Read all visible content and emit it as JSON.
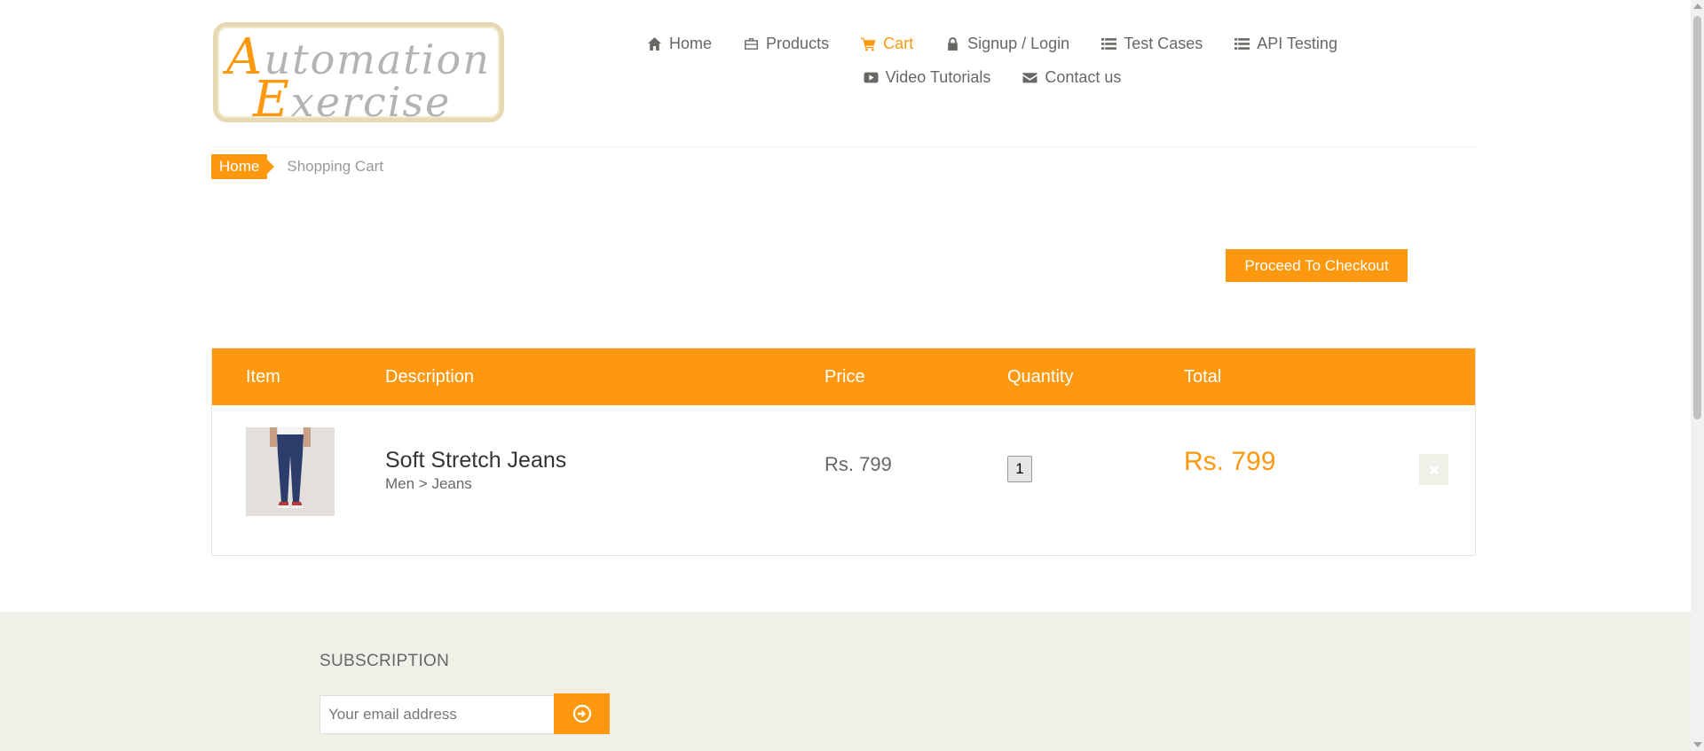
{
  "logo": {
    "line1_cap": "A",
    "line1_rest": "utomation",
    "line2_cap": "E",
    "line2_rest": "xercise"
  },
  "nav": {
    "items": [
      {
        "label": "Home",
        "icon": "home-icon"
      },
      {
        "label": "Products",
        "icon": "briefcase-icon"
      },
      {
        "label": "Cart",
        "icon": "cart-icon",
        "active": true
      },
      {
        "label": "Signup / Login",
        "icon": "lock-icon"
      },
      {
        "label": "Test Cases",
        "icon": "list-icon"
      },
      {
        "label": "API Testing",
        "icon": "list-icon"
      },
      {
        "label": "Video Tutorials",
        "icon": "youtube-icon"
      },
      {
        "label": "Contact us",
        "icon": "envelope-icon"
      }
    ]
  },
  "breadcrumb": {
    "home": "Home",
    "current": "Shopping Cart"
  },
  "checkout": {
    "label": "Proceed To Checkout"
  },
  "cart": {
    "headers": {
      "item": "Item",
      "description": "Description",
      "price": "Price",
      "quantity": "Quantity",
      "total": "Total"
    },
    "rows": [
      {
        "name": "Soft Stretch Jeans",
        "category": "Men > Jeans",
        "price": "Rs. 799",
        "quantity": "1",
        "total": "Rs. 799"
      }
    ]
  },
  "subscription": {
    "title": "SUBSCRIPTION",
    "placeholder": "Your email address"
  },
  "colors": {
    "accent": "#fe980f",
    "footer_bg": "#f0f0e9",
    "text": "#696763"
  }
}
